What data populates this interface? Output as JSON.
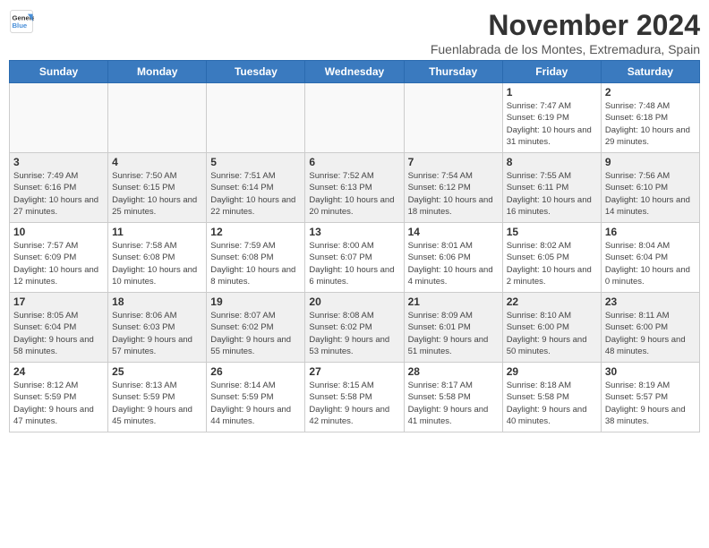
{
  "logo": {
    "line1": "General",
    "line2": "Blue"
  },
  "title": "November 2024",
  "subtitle": "Fuenlabrada de los Montes, Extremadura, Spain",
  "days_of_week": [
    "Sunday",
    "Monday",
    "Tuesday",
    "Wednesday",
    "Thursday",
    "Friday",
    "Saturday"
  ],
  "weeks": [
    [
      {
        "day": "",
        "info": ""
      },
      {
        "day": "",
        "info": ""
      },
      {
        "day": "",
        "info": ""
      },
      {
        "day": "",
        "info": ""
      },
      {
        "day": "",
        "info": ""
      },
      {
        "day": "1",
        "info": "Sunrise: 7:47 AM\nSunset: 6:19 PM\nDaylight: 10 hours and 31 minutes."
      },
      {
        "day": "2",
        "info": "Sunrise: 7:48 AM\nSunset: 6:18 PM\nDaylight: 10 hours and 29 minutes."
      }
    ],
    [
      {
        "day": "3",
        "info": "Sunrise: 7:49 AM\nSunset: 6:16 PM\nDaylight: 10 hours and 27 minutes."
      },
      {
        "day": "4",
        "info": "Sunrise: 7:50 AM\nSunset: 6:15 PM\nDaylight: 10 hours and 25 minutes."
      },
      {
        "day": "5",
        "info": "Sunrise: 7:51 AM\nSunset: 6:14 PM\nDaylight: 10 hours and 22 minutes."
      },
      {
        "day": "6",
        "info": "Sunrise: 7:52 AM\nSunset: 6:13 PM\nDaylight: 10 hours and 20 minutes."
      },
      {
        "day": "7",
        "info": "Sunrise: 7:54 AM\nSunset: 6:12 PM\nDaylight: 10 hours and 18 minutes."
      },
      {
        "day": "8",
        "info": "Sunrise: 7:55 AM\nSunset: 6:11 PM\nDaylight: 10 hours and 16 minutes."
      },
      {
        "day": "9",
        "info": "Sunrise: 7:56 AM\nSunset: 6:10 PM\nDaylight: 10 hours and 14 minutes."
      }
    ],
    [
      {
        "day": "10",
        "info": "Sunrise: 7:57 AM\nSunset: 6:09 PM\nDaylight: 10 hours and 12 minutes."
      },
      {
        "day": "11",
        "info": "Sunrise: 7:58 AM\nSunset: 6:08 PM\nDaylight: 10 hours and 10 minutes."
      },
      {
        "day": "12",
        "info": "Sunrise: 7:59 AM\nSunset: 6:08 PM\nDaylight: 10 hours and 8 minutes."
      },
      {
        "day": "13",
        "info": "Sunrise: 8:00 AM\nSunset: 6:07 PM\nDaylight: 10 hours and 6 minutes."
      },
      {
        "day": "14",
        "info": "Sunrise: 8:01 AM\nSunset: 6:06 PM\nDaylight: 10 hours and 4 minutes."
      },
      {
        "day": "15",
        "info": "Sunrise: 8:02 AM\nSunset: 6:05 PM\nDaylight: 10 hours and 2 minutes."
      },
      {
        "day": "16",
        "info": "Sunrise: 8:04 AM\nSunset: 6:04 PM\nDaylight: 10 hours and 0 minutes."
      }
    ],
    [
      {
        "day": "17",
        "info": "Sunrise: 8:05 AM\nSunset: 6:04 PM\nDaylight: 9 hours and 58 minutes."
      },
      {
        "day": "18",
        "info": "Sunrise: 8:06 AM\nSunset: 6:03 PM\nDaylight: 9 hours and 57 minutes."
      },
      {
        "day": "19",
        "info": "Sunrise: 8:07 AM\nSunset: 6:02 PM\nDaylight: 9 hours and 55 minutes."
      },
      {
        "day": "20",
        "info": "Sunrise: 8:08 AM\nSunset: 6:02 PM\nDaylight: 9 hours and 53 minutes."
      },
      {
        "day": "21",
        "info": "Sunrise: 8:09 AM\nSunset: 6:01 PM\nDaylight: 9 hours and 51 minutes."
      },
      {
        "day": "22",
        "info": "Sunrise: 8:10 AM\nSunset: 6:00 PM\nDaylight: 9 hours and 50 minutes."
      },
      {
        "day": "23",
        "info": "Sunrise: 8:11 AM\nSunset: 6:00 PM\nDaylight: 9 hours and 48 minutes."
      }
    ],
    [
      {
        "day": "24",
        "info": "Sunrise: 8:12 AM\nSunset: 5:59 PM\nDaylight: 9 hours and 47 minutes."
      },
      {
        "day": "25",
        "info": "Sunrise: 8:13 AM\nSunset: 5:59 PM\nDaylight: 9 hours and 45 minutes."
      },
      {
        "day": "26",
        "info": "Sunrise: 8:14 AM\nSunset: 5:59 PM\nDaylight: 9 hours and 44 minutes."
      },
      {
        "day": "27",
        "info": "Sunrise: 8:15 AM\nSunset: 5:58 PM\nDaylight: 9 hours and 42 minutes."
      },
      {
        "day": "28",
        "info": "Sunrise: 8:17 AM\nSunset: 5:58 PM\nDaylight: 9 hours and 41 minutes."
      },
      {
        "day": "29",
        "info": "Sunrise: 8:18 AM\nSunset: 5:58 PM\nDaylight: 9 hours and 40 minutes."
      },
      {
        "day": "30",
        "info": "Sunrise: 8:19 AM\nSunset: 5:57 PM\nDaylight: 9 hours and 38 minutes."
      }
    ]
  ]
}
